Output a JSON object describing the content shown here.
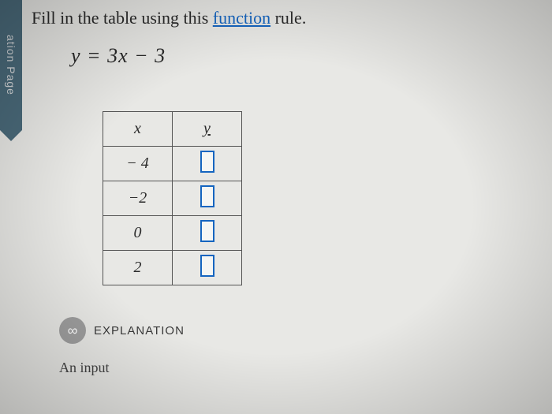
{
  "side_tab": "ation Page",
  "instruction": {
    "prefix": "Fill in the table using this ",
    "link": "function",
    "suffix": " rule."
  },
  "equation": "y = 3x − 3",
  "table": {
    "headers": {
      "x": "x",
      "y": "y"
    },
    "rows": [
      {
        "x": "− 4",
        "y": ""
      },
      {
        "x": "−2",
        "y": ""
      },
      {
        "x": "0",
        "y": ""
      },
      {
        "x": "2",
        "y": ""
      }
    ]
  },
  "explanation": {
    "icon": "∞",
    "label": "EXPLANATION"
  },
  "footer": "An input"
}
